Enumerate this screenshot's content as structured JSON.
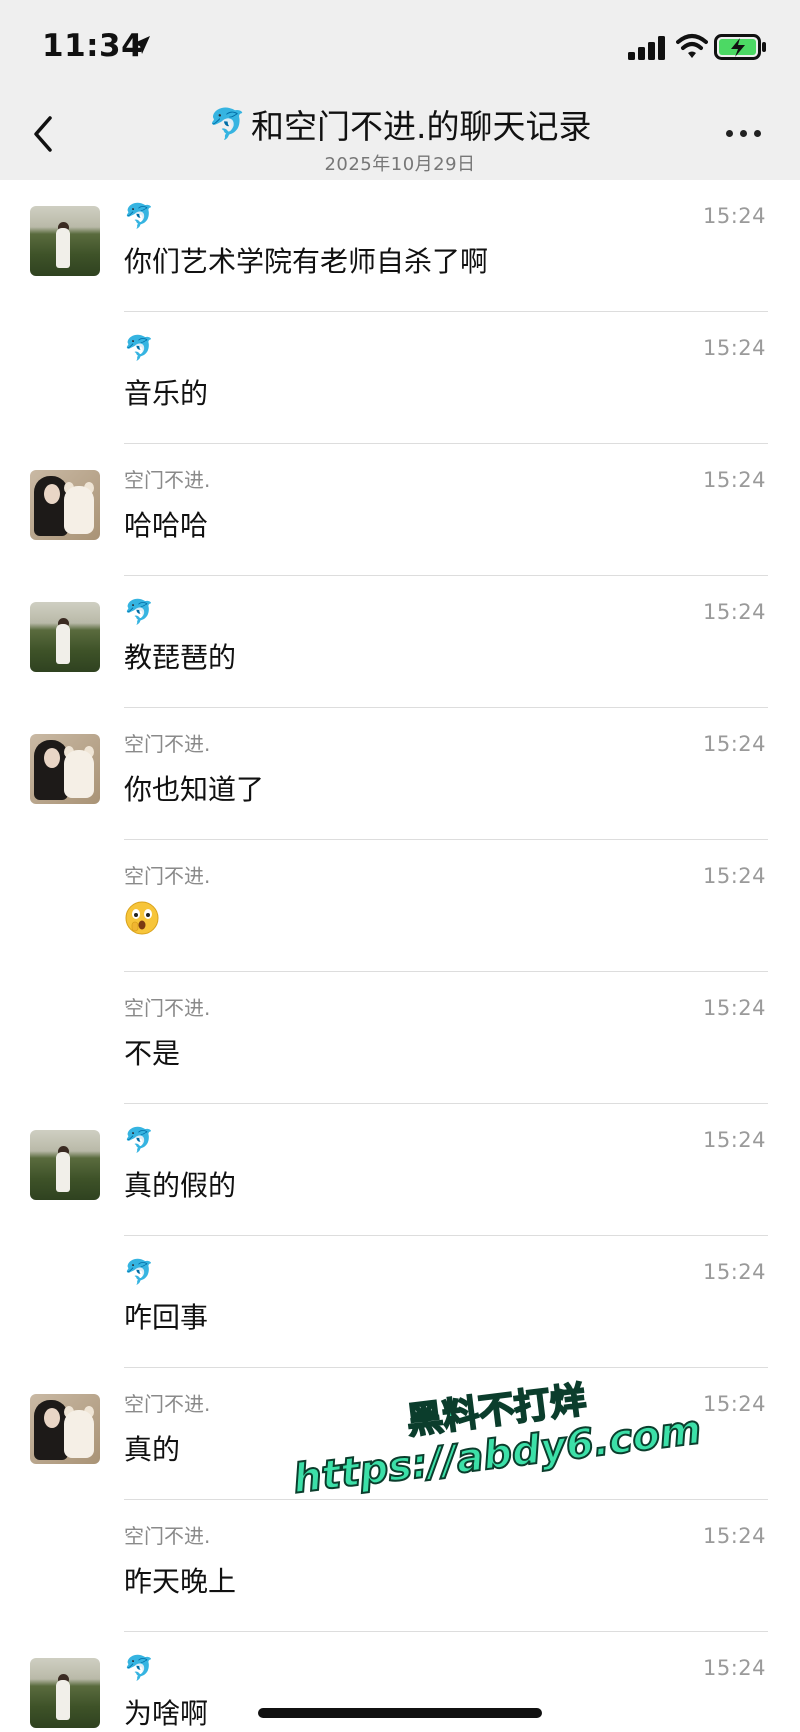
{
  "status_bar": {
    "time": "11:34"
  },
  "header": {
    "title_emoji": "🐬",
    "title": "和空门不进.的聊天记录",
    "date": "2025年10月29日"
  },
  "messages": [
    {
      "sender_name": "",
      "sender_emoji": "🐬",
      "time": "15:24",
      "text": "你们艺术学院有老师自杀了啊",
      "avatar": "landscape"
    },
    {
      "sender_name": "",
      "sender_emoji": "🐬",
      "time": "15:24",
      "text": "音乐的",
      "avatar": ""
    },
    {
      "sender_name": "空门不进.",
      "sender_emoji": "",
      "time": "15:24",
      "text": "哈哈哈",
      "avatar": "person"
    },
    {
      "sender_name": "",
      "sender_emoji": "🐬",
      "time": "15:24",
      "text": "教琵琶的",
      "avatar": "landscape"
    },
    {
      "sender_name": "空门不进.",
      "sender_emoji": "",
      "time": "15:24",
      "text": "你也知道了",
      "avatar": "person"
    },
    {
      "sender_name": "空门不进.",
      "sender_emoji": "",
      "time": "15:24",
      "text": "",
      "emoji": "shocked-face-icon",
      "avatar": ""
    },
    {
      "sender_name": "空门不进.",
      "sender_emoji": "",
      "time": "15:24",
      "text": "不是",
      "avatar": ""
    },
    {
      "sender_name": "",
      "sender_emoji": "🐬",
      "time": "15:24",
      "text": "真的假的",
      "avatar": "landscape"
    },
    {
      "sender_name": "",
      "sender_emoji": "🐬",
      "time": "15:24",
      "text": "咋回事",
      "avatar": ""
    },
    {
      "sender_name": "空门不进.",
      "sender_emoji": "",
      "time": "15:24",
      "text": "真的",
      "avatar": "person"
    },
    {
      "sender_name": "空门不进.",
      "sender_emoji": "",
      "time": "15:24",
      "text": "昨天晚上",
      "avatar": ""
    },
    {
      "sender_name": "",
      "sender_emoji": "🐬",
      "time": "15:24",
      "text": "为啥啊",
      "avatar": "landscape"
    }
  ],
  "watermark": {
    "line1": "黑料不打烊",
    "line2": "https://abdy6.com"
  },
  "colors": {
    "header_bg": "#efefef",
    "divider": "#dddddd",
    "watermark": "#3ce0a8"
  }
}
